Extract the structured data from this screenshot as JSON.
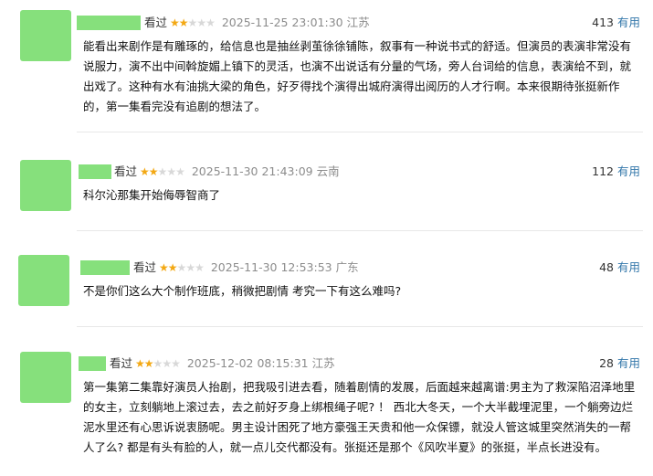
{
  "reviews": [
    {
      "seen_label": "看过",
      "stars": [
        true,
        true,
        false,
        false,
        false
      ],
      "date": "2025-11-25 23:01:30",
      "location": "江苏",
      "useful_count": "413",
      "useful_label": "有用",
      "content": "能看出来剧作是有雕琢的，给信息也是抽丝剥茧徐徐铺陈，叙事有一种说书式的舒适。但演员的表演非常没有说服力，演不出中间斡旋媚上镇下的灵活，也演不出说话有分量的气场，旁人台词给的信息，表演给不到，就出戏了。这种有水有油挑大梁的角色，好歹得找个演得出城府演得出阅历的人才行啊。本来很期待张挺新作的，第一集看完没有追剧的想法了。"
    },
    {
      "seen_label": "看过",
      "stars": [
        true,
        true,
        false,
        false,
        false
      ],
      "date": "2025-11-30 21:43:09",
      "location": "云南",
      "useful_count": "112",
      "useful_label": "有用",
      "content": "科尔沁那集开始侮辱智商了"
    },
    {
      "seen_label": "看过",
      "stars": [
        true,
        true,
        false,
        false,
        false
      ],
      "date": "2025-11-30 12:53:53",
      "location": "广东",
      "useful_count": "48",
      "useful_label": "有用",
      "content": "不是你们这么大个制作班底，稍微把剧情 考究一下有这么难吗?"
    },
    {
      "seen_label": "看过",
      "stars": [
        true,
        true,
        false,
        false,
        false
      ],
      "date": "2025-12-02 08:15:31",
      "location": "江苏",
      "useful_count": "28",
      "useful_label": "有用",
      "content": "第一集第二集靠好演员人抬剧，把我吸引进去看，随着剧情的发展，后面越来越离谱:男主为了救深陷沼泽地里的女主，立刻躺地上滚过去，去之前好歹身上绑根绳子呢? ！ 西北大冬天，一个大半截埋泥里，一个躺旁边烂泥水里还有心思诉说衷肠呢。男主设计困死了地方豪强王天贵和他一众保镖，就没人管这城里突然消失的一帮人了么? 都是有头有脸的人，就一点儿交代都没有。张挺还是那个《风吹半夏》的张挺，半点长进没有。"
    }
  ]
}
